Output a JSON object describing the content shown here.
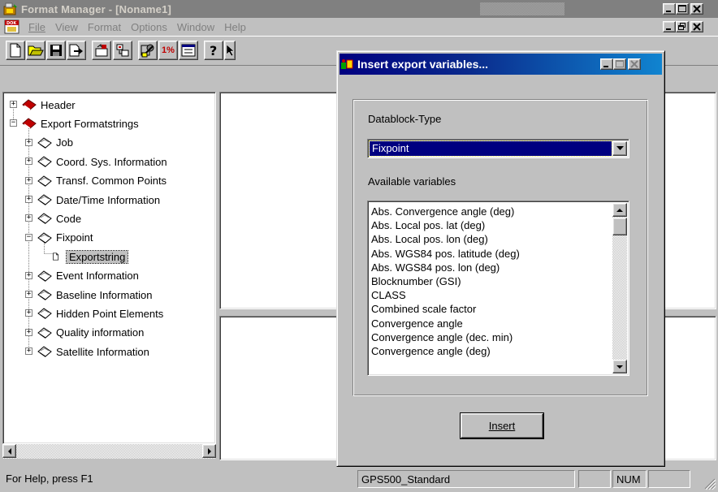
{
  "app": {
    "title": "Format Manager - [Noname1]"
  },
  "menu": {
    "items": [
      {
        "label": "File",
        "enabled": false
      },
      {
        "label": "View",
        "enabled": false
      },
      {
        "label": "Format",
        "enabled": false
      },
      {
        "label": "Options",
        "enabled": false
      },
      {
        "label": "Window",
        "enabled": false
      },
      {
        "label": "Help",
        "enabled": false
      }
    ]
  },
  "toolbar": {
    "buttons": [
      "new-file-icon",
      "open-folder-icon",
      "save-icon",
      "export-icon",
      "import-format-icon",
      "copy-format-icon",
      "settings-tool-icon",
      "percent-icon",
      "properties-icon",
      "help-icon",
      "context-help-icon"
    ],
    "percent_label": "1%"
  },
  "tree": {
    "nodes": [
      {
        "label": "Header",
        "level": 0,
        "expander": "+",
        "icon": "red-book-icon"
      },
      {
        "label": "Export Formatstrings",
        "level": 0,
        "expander": "-",
        "icon": "red-book-icon"
      },
      {
        "label": "Job",
        "level": 1,
        "expander": "+",
        "icon": "white-book-icon"
      },
      {
        "label": "Coord. Sys. Information",
        "level": 1,
        "expander": "+",
        "icon": "white-book-icon"
      },
      {
        "label": "Transf. Common Points",
        "level": 1,
        "expander": "+",
        "icon": "white-book-icon"
      },
      {
        "label": "Date/Time Information",
        "level": 1,
        "expander": "+",
        "icon": "white-book-icon"
      },
      {
        "label": "Code",
        "level": 1,
        "expander": "+",
        "icon": "white-book-icon"
      },
      {
        "label": "Fixpoint",
        "level": 1,
        "expander": "-",
        "icon": "white-book-icon"
      },
      {
        "label": "Exportstring",
        "level": 2,
        "expander": "",
        "icon": "document-icon",
        "selected": true
      },
      {
        "label": "Event Information",
        "level": 1,
        "expander": "+",
        "icon": "white-book-icon"
      },
      {
        "label": "Baseline Information",
        "level": 1,
        "expander": "+",
        "icon": "white-book-icon"
      },
      {
        "label": "Hidden Point Elements",
        "level": 1,
        "expander": "+",
        "icon": "white-book-icon"
      },
      {
        "label": "Quality information",
        "level": 1,
        "expander": "+",
        "icon": "white-book-icon"
      },
      {
        "label": "Satellite Information",
        "level": 1,
        "expander": "+",
        "icon": "white-book-icon"
      }
    ]
  },
  "status": {
    "help": "For Help, press F1",
    "format": "GPS500_Standard",
    "num": "NUM"
  },
  "dialog": {
    "title": "Insert export variables...",
    "datablock_label": "Datablock-Type",
    "datablock_value": "Fixpoint",
    "available_label": "Available variables",
    "variables": [
      "Abs. Convergence angle (deg)",
      "Abs. Local pos. lat (deg)",
      "Abs. Local pos. lon (deg)",
      "Abs. WGS84 pos. latitude (deg)",
      "Abs. WGS84 pos. lon (deg)",
      "Blocknumber (GSI)",
      "CLASS",
      "Combined scale factor",
      "Convergence angle",
      "Convergence angle (dec. min)",
      "Convergence angle (deg)"
    ],
    "insert_label": "Insert"
  },
  "colors": {
    "face": "#c0c0c0",
    "selection": "#000080",
    "dialog_title_start": "#000080",
    "dialog_title_end": "#1084d0"
  }
}
